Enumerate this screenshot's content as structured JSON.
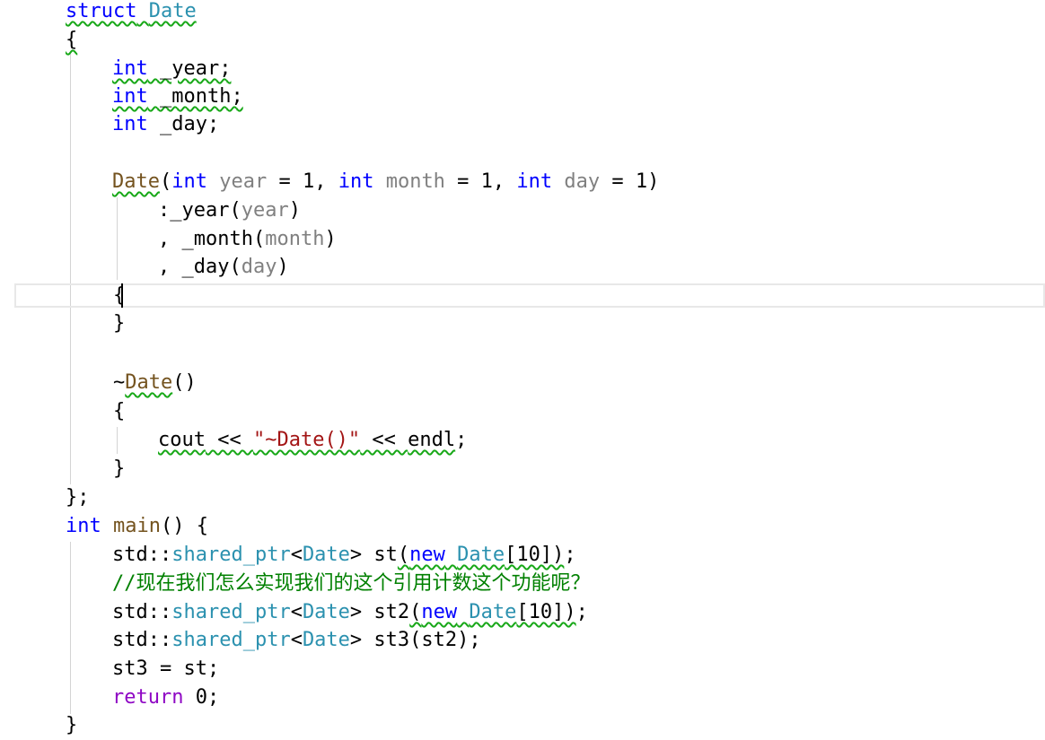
{
  "editor": {
    "lines": [
      {
        "tokens": [
          {
            "t": "struct",
            "c": "kw",
            "sq": true
          },
          {
            "t": " ",
            "sq": true
          },
          {
            "t": "Date",
            "c": "ty",
            "sq": true
          }
        ]
      },
      {
        "tokens": [
          {
            "t": "{",
            "sq": true
          }
        ]
      },
      {
        "tokens": [
          {
            "t": "int",
            "c": "kw",
            "sq": true
          },
          {
            "t": " _year;",
            "sq": true
          }
        ]
      },
      {
        "tokens": [
          {
            "t": "int",
            "c": "kw",
            "sq": true
          },
          {
            "t": " _month;",
            "sq": true
          }
        ]
      },
      {
        "tokens": [
          {
            "t": "int",
            "c": "kw"
          },
          {
            "t": " _day;"
          }
        ]
      },
      {
        "tokens": []
      },
      {
        "tokens": [
          {
            "t": "Date",
            "c": "fn",
            "sq": true
          },
          {
            "t": "("
          },
          {
            "t": "int",
            "c": "kw"
          },
          {
            "t": " "
          },
          {
            "t": "year",
            "c": "pm"
          },
          {
            "t": " = 1, "
          },
          {
            "t": "int",
            "c": "kw"
          },
          {
            "t": " "
          },
          {
            "t": "month",
            "c": "pm"
          },
          {
            "t": " = 1, "
          },
          {
            "t": "int",
            "c": "kw"
          },
          {
            "t": " "
          },
          {
            "t": "day",
            "c": "pm"
          },
          {
            "t": " = 1)"
          }
        ]
      },
      {
        "tokens": [
          {
            "t": ":_year("
          },
          {
            "t": "year",
            "c": "pm"
          },
          {
            "t": ")"
          }
        ]
      },
      {
        "tokens": [
          {
            "t": ", _month("
          },
          {
            "t": "month",
            "c": "pm"
          },
          {
            "t": ")"
          }
        ]
      },
      {
        "tokens": [
          {
            "t": ", _day("
          },
          {
            "t": "day",
            "c": "pm"
          },
          {
            "t": ")"
          }
        ]
      },
      {
        "tokens": [
          {
            "t": "{"
          }
        ]
      },
      {
        "tokens": [
          {
            "t": "}"
          }
        ]
      },
      {
        "tokens": []
      },
      {
        "tokens": [
          {
            "t": "~"
          },
          {
            "t": "Date",
            "c": "fn",
            "sq": true
          },
          {
            "t": "()"
          }
        ]
      },
      {
        "tokens": [
          {
            "t": "{"
          }
        ]
      },
      {
        "tokens": [
          {
            "t": "cout",
            "sq": true
          },
          {
            "t": " << ",
            "sq": true
          },
          {
            "t": "\"~Date()\"",
            "c": "st",
            "sq": true
          },
          {
            "t": " << ",
            "sq": true
          },
          {
            "t": "endl",
            "sq": true
          },
          {
            "t": ";"
          }
        ]
      },
      {
        "tokens": [
          {
            "t": "}"
          }
        ]
      },
      {
        "tokens": [
          {
            "t": "};"
          }
        ]
      },
      {
        "tokens": [
          {
            "t": "int",
            "c": "kw"
          },
          {
            "t": " "
          },
          {
            "t": "main",
            "c": "fn"
          },
          {
            "t": "() {"
          }
        ]
      },
      {
        "tokens": [
          {
            "t": "std::"
          },
          {
            "t": "shared_ptr",
            "c": "ty"
          },
          {
            "t": "<"
          },
          {
            "t": "Date",
            "c": "ty"
          },
          {
            "t": "> st"
          },
          {
            "t": "(",
            "sq": true
          },
          {
            "t": "new",
            "c": "kw",
            "sq": true
          },
          {
            "t": " ",
            "sq": true
          },
          {
            "t": "Date",
            "c": "ty",
            "sq": true
          },
          {
            "t": "[10])",
            "sq": true
          },
          {
            "t": ";"
          }
        ]
      },
      {
        "tokens": [
          {
            "t": "//现在我们怎么实现我们的这个引用计数这个功能呢？",
            "c": "cm"
          }
        ]
      },
      {
        "tokens": [
          {
            "t": "std::"
          },
          {
            "t": "shared_ptr",
            "c": "ty"
          },
          {
            "t": "<"
          },
          {
            "t": "Date",
            "c": "ty"
          },
          {
            "t": "> st2"
          },
          {
            "t": "(",
            "sq": true
          },
          {
            "t": "new",
            "c": "kw",
            "sq": true
          },
          {
            "t": " ",
            "sq": true
          },
          {
            "t": "Date",
            "c": "ty",
            "sq": true
          },
          {
            "t": "[10])",
            "sq": true
          },
          {
            "t": ";"
          }
        ]
      },
      {
        "tokens": [
          {
            "t": "std::"
          },
          {
            "t": "shared_ptr",
            "c": "ty"
          },
          {
            "t": "<"
          },
          {
            "t": "Date",
            "c": "ty"
          },
          {
            "t": "> st3(st2);"
          }
        ]
      },
      {
        "tokens": [
          {
            "t": "st3 = st;"
          }
        ]
      },
      {
        "tokens": [
          {
            "t": "return",
            "c": "ret"
          },
          {
            "t": " 0;"
          }
        ]
      },
      {
        "tokens": [
          {
            "t": "}"
          }
        ]
      }
    ],
    "current_line": 11
  }
}
